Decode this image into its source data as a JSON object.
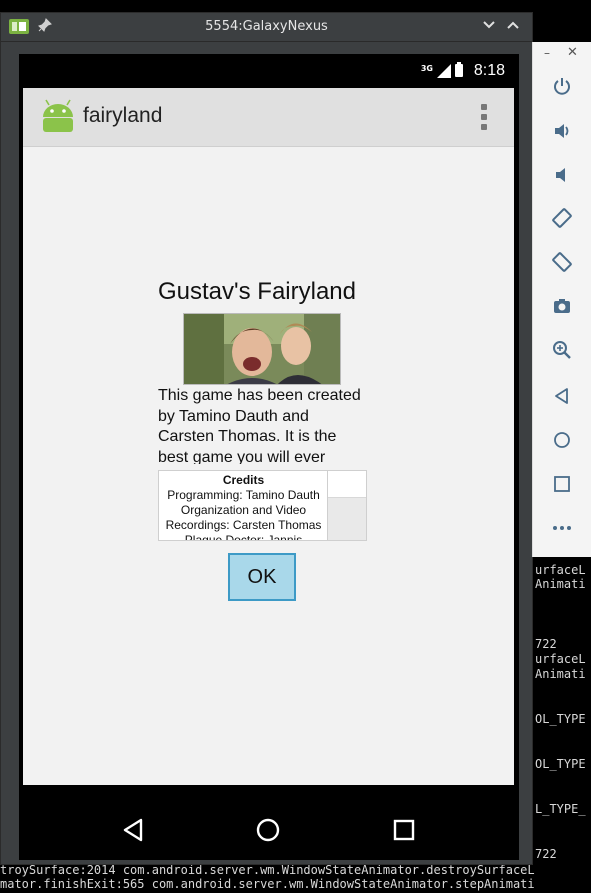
{
  "window": {
    "title": "5554:GalaxyNexus"
  },
  "status_bar": {
    "network": "3G",
    "time": "8:18"
  },
  "action_bar": {
    "app_name": "fairyland"
  },
  "content": {
    "title": "Gustav's Fairyland",
    "description": "This game has been created by Tamino Dauth and Carsten Thomas. It is the best game you will ever",
    "credits": {
      "header": "Credits",
      "lines": [
        "Programming: Tamino Dauth",
        "Organization and Video",
        "Recordings: Carsten Thomas",
        "Plague Doctor: Jannis"
      ]
    },
    "ok_label": "OK"
  },
  "terminal": {
    "lines_right": [
      "urfaceL",
      "Animati",
      "722",
      "urfaceL",
      "Animati",
      "OL_TYPE",
      "OL_TYPE",
      "L_TYPE_",
      "722"
    ],
    "bottom_lines": [
      "troySurface:2014 com.android.server.wm.WindowStateAnimator.destroySurfaceL",
      "mator.finishExit:565 com.android.server.wm.WindowStateAnimator.stepAnimati"
    ]
  },
  "colors": {
    "ok_fill": "#a9d8ea",
    "ok_border": "#3d9ac6",
    "android_green": "#8bc34a"
  }
}
